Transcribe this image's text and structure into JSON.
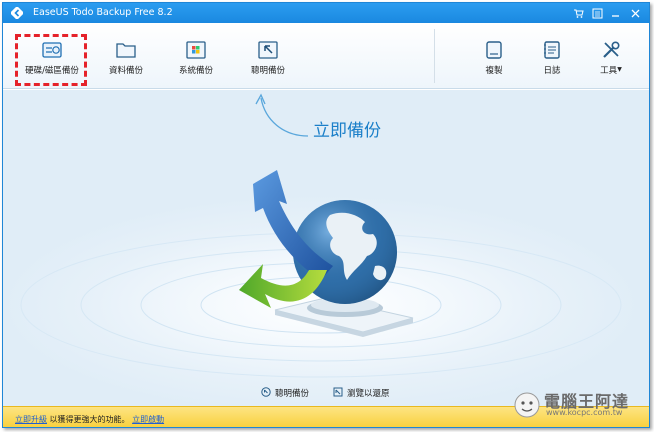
{
  "window": {
    "title": "EaseUS Todo Backup Free 8.2"
  },
  "toolbar": {
    "items": [
      {
        "label": "硬碟/磁區備份",
        "icon": "disk-partition-backup-icon"
      },
      {
        "label": "資料備份",
        "icon": "folder-icon"
      },
      {
        "label": "系統備份",
        "icon": "windows-system-icon"
      },
      {
        "label": "聰明備份",
        "icon": "cursor-smart-icon"
      }
    ],
    "right_items": [
      {
        "label": "複製",
        "icon": "clone-icon"
      },
      {
        "label": "日誌",
        "icon": "log-icon"
      },
      {
        "label": "工具",
        "icon": "tools-icon"
      }
    ]
  },
  "main": {
    "backup_now_label": "立即備份",
    "bottom_links": [
      {
        "label": "聰明備份",
        "icon": "smart-backup-icon"
      },
      {
        "label": "瀏覽以還原",
        "icon": "browse-restore-icon"
      }
    ]
  },
  "statusbar": {
    "upgrade_link": "立即升級",
    "message": " 以獲得更強大的功能。",
    "activate_link": "立即啟動"
  },
  "watermark": {
    "brand": "電腦王阿達",
    "url": "www.kocpc.com.tw"
  },
  "colors": {
    "titlebar": "#1a88e0",
    "accent": "#1a7fc9",
    "highlight_border": "#e5222a",
    "statusbar": "#f8cf39"
  }
}
